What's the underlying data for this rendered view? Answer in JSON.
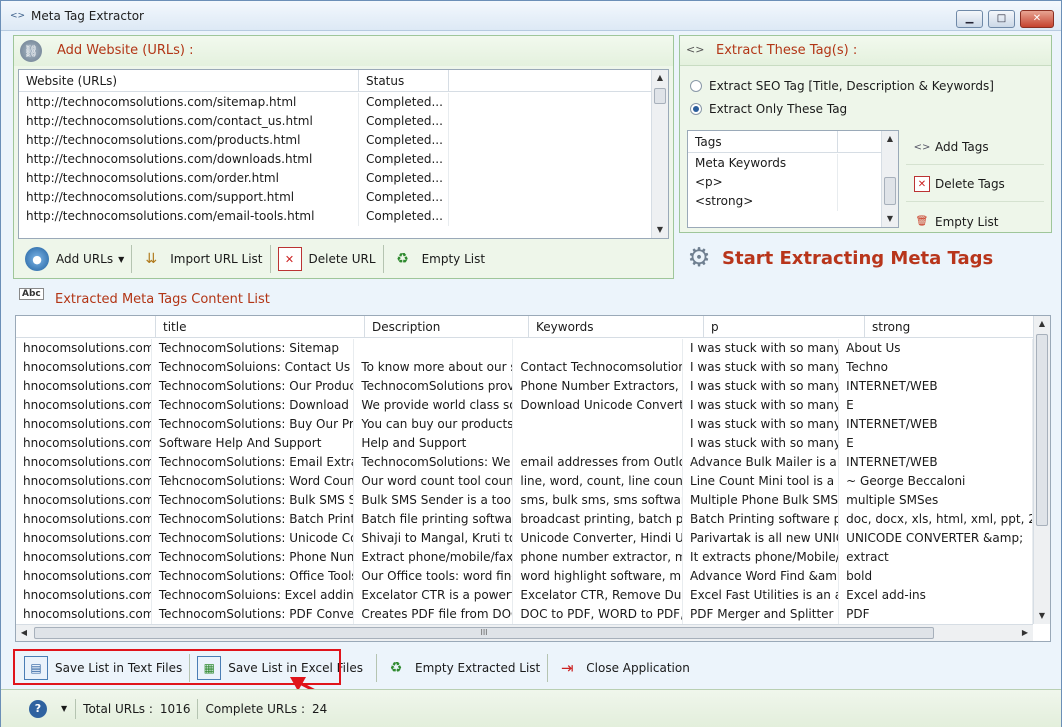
{
  "window": {
    "title": "Meta Tag Extractor",
    "controls": {
      "minimize": "▁",
      "maximize": "□",
      "close": "✕"
    }
  },
  "add_website": {
    "title": "Add Website (URLs) :",
    "icon": "link-icon",
    "columns": [
      "Website (URLs)",
      "Status"
    ],
    "rows": [
      [
        "http://technocomsolutions.com/sitemap.html",
        "Completed..."
      ],
      [
        "http://technocomsolutions.com/contact_us.html",
        "Completed..."
      ],
      [
        "http://technocomsolutions.com/products.html",
        "Completed..."
      ],
      [
        "http://technocomsolutions.com/downloads.html",
        "Completed..."
      ],
      [
        "http://technocomsolutions.com/order.html",
        "Completed..."
      ],
      [
        "http://technocomsolutions.com/support.html",
        "Completed..."
      ],
      [
        "http://technocomsolutions.com/email-tools.html",
        "Completed..."
      ]
    ],
    "toolbar": {
      "add_urls": "Add URLs",
      "import_url_list": "Import URL List",
      "delete_url": "Delete URL",
      "empty_list": "Empty List"
    }
  },
  "extract_tags": {
    "title": "Extract These Tag(s) :",
    "option_seo": "Extract SEO Tag [Title, Description & Keywords]",
    "option_only": "Extract Only These Tag",
    "selected_option": "only",
    "tags_header": "Tags",
    "tags": [
      "Meta Keywords",
      "<p>",
      "<strong>"
    ],
    "add_tags": "Add Tags",
    "delete_tags": "Delete Tags",
    "empty_list": "Empty List"
  },
  "start_button": {
    "label": "Start Extracting Meta Tags"
  },
  "extracted": {
    "title": "Extracted Meta Tags Content List",
    "columns": [
      "",
      "title",
      "Description",
      "Keywords",
      "p",
      "strong"
    ],
    "rows": [
      [
        "hnocomsolutions.com/...",
        "TechnocomSolutions: Sitemap",
        "",
        "",
        "I was stuck with so many E...",
        "About Us"
      ],
      [
        "hnocomsolutions.com/...",
        "TechnocomSoluions: Contact Us",
        "To know more about our s...",
        "Contact Technocomsolution...",
        "I was stuck with so many E...",
        "Techno"
      ],
      [
        "hnocomsolutions.com/...",
        "TechnocomSolutions: Our Products",
        "TechnocomSolutions provi...",
        "Phone Number Extractors, Ex...",
        "I was stuck with so many E...",
        "INTERNET/WEB"
      ],
      [
        "hnocomsolutions.com/...",
        "TechnocomSolutions:  Download S...",
        "We provide world class sof...",
        "Download Unicode Converte...",
        "I was stuck with so many E...",
        "E"
      ],
      [
        "hnocomsolutions.com/...",
        "TechnocomSolutions: Buy Our Pro...",
        "You can buy our products ...",
        "",
        "I was stuck with so many E...",
        "INTERNET/WEB"
      ],
      [
        "hnocomsolutions.com/...",
        "Software Help And Support",
        "Help and Support",
        "",
        "I was stuck with so many E...",
        "E"
      ],
      [
        "hnocomsolutions.com/...",
        "TechnocomSolutions: Email Extract...",
        "TechnocomSolutions: We ...",
        "email addresses from Outloo...",
        "Advance Bulk Mailer is a t...",
        "INTERNET/WEB"
      ],
      [
        "hnocomsolutions.com/...",
        "TehcnocomSolutions: Word Count ...",
        "Our word count tool count...",
        "line, word, count, line count, ...",
        "Line Count Mini tool is a w...",
        "~  George Beccaloni"
      ],
      [
        "hnocomsolutions.com/...",
        "TechnocomSolutions: Bulk SMS Sof...",
        "Bulk SMS Sender is a tool t...",
        "sms, bulk sms, sms software,...",
        "Multiple Phone Bulk SMS ...",
        "multiple SMSes"
      ],
      [
        "hnocomsolutions.com/...",
        "TechnocomSolutions: Batch Printin...",
        "Batch file printing software...",
        "broadcast printing, batch pri...",
        "Batch Printing software pri...",
        "doc, docx, xls, html, xml, ppt, 2"
      ],
      [
        "hnocomsolutions.com/...",
        "TechnocomSolutions: Unicode Con...",
        "Shivaji to Mangal, Kruti to ...",
        "Unicode Converter, Hindi Un...",
        "Parivartak is all new UNIC...",
        "UNICODE CONVERTER &amp;"
      ],
      [
        "hnocomsolutions.com/...",
        "TechnocomSolutions: Phone Num...",
        "Extract phone/mobile/fax ...",
        "phone number extractor, mo...",
        "It extracts phone/Mobile/F...",
        "extract"
      ],
      [
        "hnocomsolutions.com/...",
        "TechnocomSolutions: Office Tools",
        "Our Office tools: word find...",
        "word highlight software, mul...",
        "Advance Word Find &amp;...",
        "bold"
      ],
      [
        "hnocomsolutions.com/...",
        "TechnocomSoluions: Excel addins",
        "Excelator CTR is a powerful...",
        "Excelator CTR, Remove Dupli...",
        "Excel Fast Utilities is an am...",
        "Excel add-ins"
      ],
      [
        "hnocomsolutions.com/...",
        "TechnocomSolutions: PDF Convert...",
        "Creates PDF file from DOC,...",
        "DOC to PDF, WORD to PDF, ...",
        "PDF Merger and Splitter is ...",
        "PDF"
      ]
    ],
    "hscroll_grip": "III"
  },
  "bottom_toolbar": {
    "save_text": "Save List in Text Files",
    "save_excel": "Save List in Excel Files",
    "empty_extracted": "Empty Extracted List",
    "close_app": "Close Application"
  },
  "status": {
    "total_urls_label": "Total URLs :",
    "total_urls_value": "1016",
    "complete_urls_label": "Complete URLs :",
    "complete_urls_value": "24"
  },
  "colors": {
    "accent_title": "#b23515",
    "highlight": "#e0141b",
    "panel_border": "#9fc69a"
  }
}
